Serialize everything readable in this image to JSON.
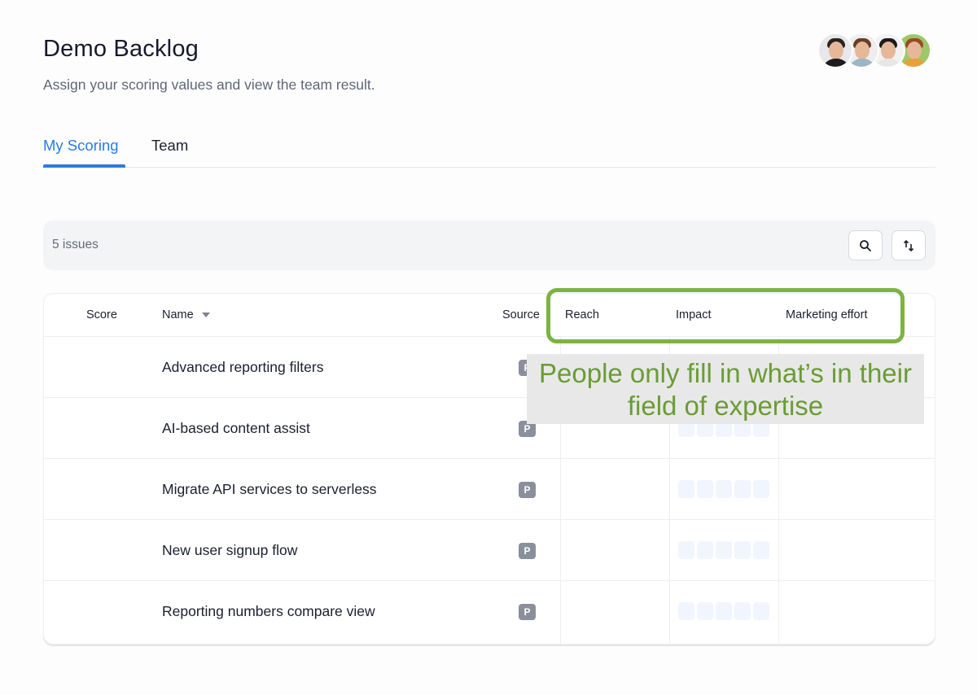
{
  "header": {
    "title": "Demo Backlog",
    "subtitle": "Assign your scoring values and view the team result."
  },
  "team_avatars": [
    {
      "name": "avatar-1",
      "hair": "#2a2320",
      "body": "#1d1d1d",
      "bg": "#e8e8ea"
    },
    {
      "name": "avatar-2",
      "hair": "#6b3d22",
      "body": "#9cb6c6",
      "bg": "#eeeef0"
    },
    {
      "name": "avatar-3",
      "hair": "#1c1a1a",
      "body": "#e8e6e4",
      "bg": "#f1f1f1"
    },
    {
      "name": "avatar-4",
      "hair": "#9b4a25",
      "body": "#e9a03b",
      "bg": "#9dc867"
    }
  ],
  "tabs": [
    {
      "label": "My Scoring",
      "active": true
    },
    {
      "label": "Team",
      "active": false
    }
  ],
  "toolbar": {
    "issue_count": "5 issues",
    "search_icon": "search-icon",
    "sort_icon": "sort-arrows-icon"
  },
  "table": {
    "columns": {
      "score": "Score",
      "name": "Name",
      "source": "Source",
      "reach": "Reach",
      "impact": "Impact",
      "marketing_effort": "Marketing effort"
    },
    "rows": [
      {
        "name": "Advanced reporting filters",
        "source": "P"
      },
      {
        "name": "AI-based content assist",
        "source": "P"
      },
      {
        "name": "Migrate API services to serverless",
        "source": "P"
      },
      {
        "name": "New user signup flow",
        "source": "P"
      },
      {
        "name": "Reporting numbers compare view",
        "source": "P"
      }
    ],
    "impact_scale_steps": 5
  },
  "annotation": {
    "callout_text": "People only fill in what’s in their field of expertise",
    "highlight_color": "#7cb342",
    "text_color": "#6a9c34"
  },
  "colors": {
    "accent": "#2b7ae2",
    "badge": "#8a8f9c",
    "pip": "#f0f5fe"
  }
}
